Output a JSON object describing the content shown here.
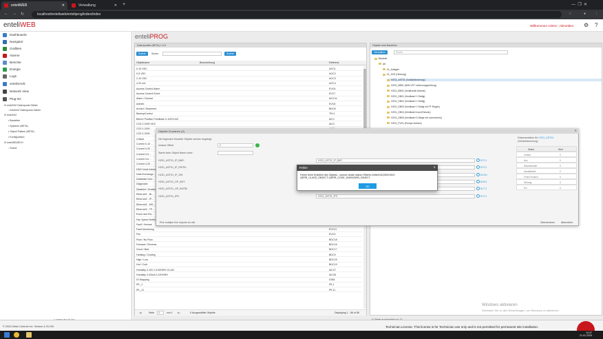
{
  "browser": {
    "tabs": [
      {
        "label": "enteliWEB",
        "active": true
      },
      {
        "label": "Verwaltung",
        "active": false
      }
    ],
    "url": "localhost/enteliweb/enteliprog/index/index"
  },
  "app": {
    "logo_prefix": "enteli",
    "logo_suffix": "WEB",
    "welcome": "Willkommen Admin",
    "logout": "Abmelden"
  },
  "sidebar": {
    "items": [
      {
        "label": "Dashboards",
        "icon": "dashboard-icon",
        "color": "#3a7cc7"
      },
      {
        "label": "Navigator",
        "icon": "navigator-icon",
        "color": "#2f6fb0"
      },
      {
        "label": "Grafiken",
        "icon": "graphics-icon",
        "color": "#2c8a3a"
      },
      {
        "label": "Alarme",
        "icon": "alarm-icon",
        "color": "#c9161d"
      },
      {
        "label": "Berichte",
        "icon": "reports-icon",
        "color": "#5a8bd0"
      },
      {
        "label": "Energie",
        "icon": "energy-icon",
        "color": "#2c9a4a"
      },
      {
        "label": "Logs",
        "icon": "logs-icon",
        "color": "#666666"
      },
      {
        "label": "enteliSAVE",
        "icon": "save-icon",
        "color": "#3a7cc7"
      },
      {
        "label": "Network View",
        "icon": "network-icon",
        "color": "#444444"
      },
      {
        "label": "Plug-ins",
        "icon": "plugin-icon",
        "color": "#555555"
      }
    ],
    "tree": [
      "enteliVIZ Datenpunkt Zähler",
      "enteliVIZ Datenpunkt Zähler",
      "enteliVIZ",
      "Bauteilen",
      "Systeme (BETA)",
      "Object Pattern (BETA)",
      "Konfiguration",
      "enteliSEARCH",
      "Suche"
    ],
    "footer": "MOS Produkte"
  },
  "page": {
    "title_prefix": "enteli",
    "title_suffix": "PROG"
  },
  "left_panel": {
    "header": "Datenpunkte (BETA) 1.0.5",
    "search_button": "Suche",
    "search_label": "Suche",
    "search_btn2": "Suche",
    "columns": [
      "Objektname",
      "Beschreibung",
      "Referenz"
    ],
    "rows": [
      [
        "0-10 VDC",
        "",
        "AOC1"
      ],
      [
        "0-5 VDC",
        "",
        "AOC2"
      ],
      [
        "2-10 VDC",
        "",
        "AOC3"
      ],
      [
        "4-20 mA",
        "",
        "AOC4"
      ],
      [
        "Access Control Alarm",
        "",
        "EVC6"
      ],
      [
        "Access Control Event",
        "",
        "EVC7"
      ],
      [
        "Alarm / Normal",
        "",
        "MCC11"
      ],
      [
        "Antrieb",
        "",
        "EVC8"
      ],
      [
        "Armed / Disarmed",
        "",
        "BDC8"
      ],
      [
        "BackupControl",
        "",
        "TEL1"
      ],
      [
        "Before Position Feedback 0-100% AIC",
        "",
        "AIC1"
      ],
      [
        "CO2 0-2000 VDC",
        "",
        "AIC2"
      ],
      [
        "CO2 0-2000 ...",
        "",
        "AIC3"
      ],
      [
        "CO2 0-2000 ...",
        "",
        "AIC4"
      ],
      [
        "Critical",
        "",
        "EVC1"
      ],
      [
        "Current 0-10 ...",
        "",
        ""
      ],
      [
        "Current 0-20 ...",
        "",
        ""
      ],
      [
        "Current 0-5 ...",
        "",
        ""
      ],
      [
        "Current 0-6 ...",
        "",
        ""
      ],
      [
        "Current 4-20 ...",
        "",
        ""
      ],
      [
        "DMX Node Alarm",
        "",
        ""
      ],
      [
        "Data Exchange ...",
        "",
        ""
      ],
      [
        "Database Infor...",
        "",
        ""
      ],
      [
        "Diagnostic",
        "",
        ""
      ],
      [
        "Disabled / Enabled",
        "",
        ""
      ],
      [
        "Ethernet1 - Br...",
        "",
        ""
      ],
      [
        "Ethernet2 - IP...",
        "",
        ""
      ],
      [
        "Ethernet2 - MS...",
        "",
        ""
      ],
      [
        "Ethernet3 - TP...",
        "",
        ""
      ],
      [
        "Event and Fla...",
        "",
        ""
      ],
      [
        "Fan Speed Settings (Sample MOC)",
        "Sample MOC object",
        "MOC1"
      ],
      [
        "Fault / Normal",
        "",
        "BDC10"
      ],
      [
        "Fault Monitoring",
        "",
        "EVC11"
      ],
      [
        "Fire",
        "",
        "EVC9"
      ],
      [
        "Flow / No Flow",
        "",
        "BDC18"
      ],
      [
        "Forward / Reverse",
        "",
        "BDC16"
      ],
      [
        "Good / Bad",
        "",
        "BDC17"
      ],
      [
        "Heating / Cooling",
        "",
        "BDC9"
      ],
      [
        "High / Low",
        "",
        "BDC15"
      ],
      [
        "Hot / Cold",
        "",
        "BDC19"
      ],
      [
        "Humidity 0-10V 0-100%RH V4 AIC",
        "",
        "AIC27"
      ],
      [
        "Humidity 4-20mA 0-100%RH",
        "",
        "AIC28"
      ],
      [
        "IO Mapping",
        "",
        "IOM1"
      ],
      [
        "IPL_1",
        "",
        "IPL1"
      ],
      [
        "IPL_11",
        "",
        "IPL11"
      ]
    ],
    "footer_page_label": "Seite",
    "footer_page": "1",
    "footer_of": "von 1",
    "footer_selected": "0 Ausgewählte Objekte",
    "footer_display": "Displaying 1 - 56 of 56"
  },
  "right_panel": {
    "header": "Objekte sind Bauteilen",
    "filter_button": "Verwalten",
    "search_label": "Suche",
    "tree": [
      {
        "label": "Bauteile",
        "indent": 0
      },
      {
        "label": "AK",
        "indent": 1
      },
      {
        "label": "01_Anlagen",
        "indent": 2
      },
      {
        "label": "01_H2S (Heizung)",
        "indent": 2
      },
      {
        "label": "H2S1_AST01 (Vorlaufsteuerung)",
        "indent": 3
      },
      {
        "label": "H2S1_BB01 (WW-VST Leitersungsprüfung)",
        "indent": 3
      },
      {
        "label": "H2S1_BB02 (Ventilventil-Nunkte)",
        "indent": 3
      },
      {
        "label": "H2S1_DB01 (Ventilwert Y-Stufig)",
        "indent": 3
      },
      {
        "label": "H2S1_DB02 (Ventilwert Y-Stufig)",
        "indent": 3
      },
      {
        "label": "H2S1_DB03 (Ventilwert Y-Stufig mit FF Regler)",
        "indent": 3
      },
      {
        "label": "H2S1_DB04 (Ventilwert Inoch/Tainsin)",
        "indent": 3
      },
      {
        "label": "H2S1_DB05 (Ventilwert 3-Wege mit Leerverkehr)",
        "indent": 3
      },
      {
        "label": "H2S1_PU01 (Pumpe einfach)",
        "indent": 3
      }
    ],
    "footer": "0 Objekt ausgewählt von 13"
  },
  "dialog": {
    "title": "Objekte Zuordnen (0)",
    "subtitle": "Die folgenden Bauteile Objekte werden angelegt:",
    "offset_label": "Instanz Offset",
    "offset_value": "0",
    "name_label": "Starte beim Objekt Name unter:",
    "fields": [
      {
        "label": "H2S1_AST01_IP_BAR:",
        "value": "H2S1_AST01_IP_BAR",
        "ref": "BTC1"
      },
      {
        "label": "H2S1_AST01_IP_EWTB:",
        "value": "",
        "ref": "BTC2"
      },
      {
        "label": "H2S1_AST01_IP_ZW:",
        "value": "",
        "ref": "BCM1"
      },
      {
        "label": "H2S1_AST01_OP_ANT:",
        "value": "",
        "ref": "BAH1"
      },
      {
        "label": "H2S1_AST01_OP_EWTB:",
        "value": "",
        "ref": "BCT1"
      },
      {
        "label": "H2S1_AST01_IPS:",
        "value": "H2S1_AST01_IPS",
        "ref": "BTC1"
      }
    ],
    "doc_label": "Dokumentation für",
    "doc_link": "H2S1_AST01",
    "doc_sub": "(Vorlaufsteuerung)",
    "status_headers": [
      "Status",
      "Wert"
    ],
    "status_rows": [
      [
        "Vorlauf",
        "0"
      ],
      [
        "Aus",
        "0"
      ],
      [
        "Wärmebedarf",
        "0"
      ],
      [
        "Handbetrieb",
        "0"
      ],
      [
        "Frost-Frostsch.",
        "0"
      ],
      [
        "Störung",
        "0"
      ],
      [
        "Ein",
        "0"
      ]
    ],
    "footer_text": "Pick multiple fine imports for site",
    "btn_apply": "Übernehmen",
    "btn_cancel": "Abbrechen"
  },
  "error": {
    "title": "Fehler",
    "message": "Fehler beim Erstellen des Objekts - cannot create object //Site/ev-Kettel/1610000.MV2: QERR_CLASS_OBJECT::QERR_CODE_UNKNOWN_OBJECT",
    "ok": "OK"
  },
  "watermark": {
    "line1": "Windows aktivieren",
    "line2": "Wechseln Sie zu den Einstellungen, um Windows zu aktivieren."
  },
  "statusbar": {
    "copyright": "© 2024 Delta Controls Inc. Version 4.29.190",
    "license": "Technician License. This license is for Technician use only and is not permitted for permanent site installation."
  },
  "taskbar": {
    "time": "14:47",
    "date": "21.01.2025"
  },
  "colors": {
    "brand": "#c9161d",
    "accent": "#1e9be3"
  }
}
